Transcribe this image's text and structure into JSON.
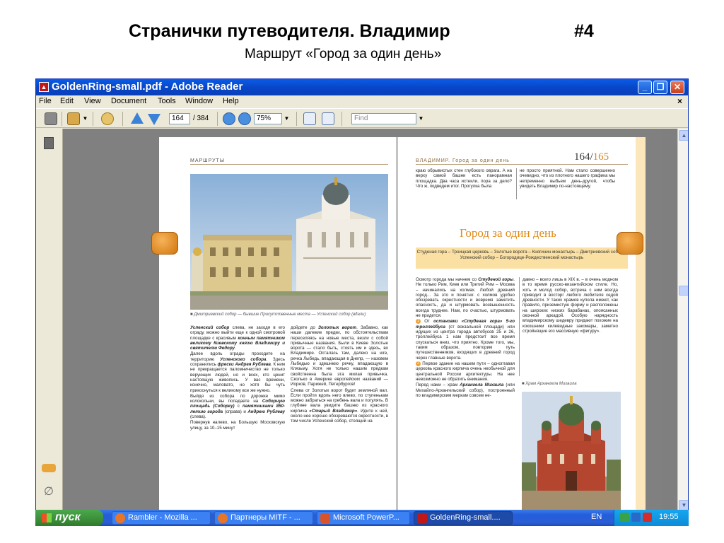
{
  "slide": {
    "title": "Странички путеводителя. Владимир",
    "number": "#4",
    "subtitle": "Маршрут «Город за один день»"
  },
  "window": {
    "title": "GoldenRing-small.pdf - Adobe Reader",
    "menu": [
      "File",
      "Edit",
      "View",
      "Document",
      "Tools",
      "Window",
      "Help"
    ],
    "close_doc": "×"
  },
  "toolbar": {
    "page_current": "164",
    "page_total": "/ 384",
    "zoom": "75%",
    "find_placeholder": "Find"
  },
  "document": {
    "left_page": {
      "running_head": "МАРШРУТЫ",
      "photo_caption": "■ Дмитриевский собор — бывшие Присутственные места — Успенский собор (вдали)",
      "col1": [
        {
          "bold": "Успенский собор",
          "text": " слева, не заходя в его ограду, можно выйти еще к одной смотровой площадке с красивым "
        },
        {
          "bold": "конным памятником великому Киевскому князю Владимиру и святителю Федору",
          "text": "."
        },
        {
          "bold": "",
          "text": "Далее вдоль ограды проходите на территорию "
        },
        {
          "bold": "Успенского собора",
          "text": ". Здесь сохранились "
        },
        {
          "bold": "фрески Андрея Рублева",
          "text": ". К ним не прекращается паломничество не только верующих людей, но и всех, кто ценит настоящую живопись. У вас времени, конечно, маловато, но хотя бы чуть прикоснуться к великому все же нужно."
        },
        {
          "bold": "",
          "text": "Выйдя из собора по дорожке мимо колокольни, вы попадаете на "
        },
        {
          "bold": "Соборную площадь (Соборку)",
          "text": " с "
        },
        {
          "bold": "памятниками 850-летию города",
          "text": " (справа) и "
        },
        {
          "bold": "Андрею Рублеву",
          "text": " (слева)."
        },
        {
          "bold": "",
          "text": "Повернув налево, на Большую Московскую улицу, за 10–15 минут"
        }
      ],
      "col2": [
        {
          "bold": "",
          "text": "дойдете до "
        },
        {
          "bold": "Золотых ворот",
          "text": ". Забавно, как наши далекие предки, по обстоятельствам переселяясь на новые места, везли с собой привычные названия. Были в Киеве Золотые ворота — стало быть, стоять им и здесь, во Владимире. Осталась там, далеко на юге, речка Лыбедь, впадающая в Днепр, — назовем Лыбедью и здешнюю речку, впадающую в Клязьму. Хотя не только нашим предкам свойственна была эта милая привычка. Сколько в Америке европейских названий — Иорков, Парижей, Петербургов!"
        },
        {
          "bold": "",
          "text": "Слева от Золотых ворот будет земляной вал. Если пройти вдоль него влево, по ступенькам можно забраться на гребень вала и погулять. В глубине вала увидите башню из красного кирпича "
        },
        {
          "bold": "«Старый Владимир»",
          "text": ". Идите к ней, около нее хорошо обозреваются окрестности, в том числе Успенский собор, стоящий на"
        }
      ]
    },
    "right_page": {
      "running_head": "ВЛАДИМИР. Город за один день",
      "page_pair_a": "164/",
      "page_pair_b": "165",
      "top_col1": "краю обрывистых стен глубокого оврага. А на верху самой башни есть панорамная площадка. Два часа истекли, пора за дело? Что ж, подведем итог. Прогулка была",
      "top_col2": "не просто приятной. Нам стало совершенно очевидно, что из плотного нашего графика мы непременно выбьем день-другой, чтобы увидеть Владимир по-настоящему.",
      "section_title": "Город за один день",
      "route": "Студеная гора – Троицкая церковь – Золотые ворота – Княгинин монастырь – Дмитриевский собор – Успенский собор – Богородице-Рождественский монастырь",
      "col1_intro_a": "Осмотр города мы начнем со ",
      "col1_intro_bold": "Студеной горы",
      "col1_intro_b": ". Не только Рим, Киев или Третий Рим – Москва – начинались на холмах. Любой древний город... За это и понятно: с холмов удобно обозревать окрестности и вовремя заметить опасность, да и штурмовать возвышенность всегда труднее. Нам, по счастью, штурмовать не придется.",
      "num1": "1",
      "col1_p2_a": " От ",
      "col1_p2_bold": "остановки «Студеная гора» 5-го троллейбуса",
      "col1_p2_b": " (ст вокзальной площади) или идущих из центра города автобусов 25 и 26, троллейбуса 1 нам предстоит все время спускаться вниз, что приятно. Кроме того, мы, таким образом, повторим путь путешественников, входящих в древний город через главные ворота.",
      "num2": "2",
      "col1_p3": " Первое здание на нашем пути – одноглавая церковь красного кирпича очень необычной для центральной России архитектуры. На нее невозможно не обратить внимания.",
      "col1_p4_a": "Перед нами – храм ",
      "col1_p4_bold": "Архангела Михаила",
      "col1_p4_b": " (или Михайло-Архангельский собор), построенный по владимирским меркам совсем не-",
      "col2_text": "давно – всего лишь в XIX в. – в очень модном в то время русско-византийском стиле. Но, хоть и молод собор, встреча с ним всегда приводит в восторг любого любителя седой древности. У таких храмов купола имеют, как правило, приземистую форму и расположены на широких низких барабанах, опоясанных оконной аркадой. Особую нарядность владимирскому шедевру придают похожие на кокошники килевидные закомары, заметно стройнящие его массивную «фигуру».",
      "photo_caption": "■ Храм Архангела Михаила"
    }
  },
  "taskbar": {
    "start_label": "пуск",
    "buttons": [
      {
        "label": "Rambler - Mozilla ..."
      },
      {
        "label": "Партнеры MITF - ..."
      },
      {
        "label": "Microsoft PowerP..."
      },
      {
        "label": "GoldenRing-small...."
      }
    ],
    "lang": "EN",
    "clock": "19:55"
  },
  "colors": {
    "accent_orange": "#e08b18",
    "route_box_bg": "#fbe0a3",
    "xp_blue": "#245edb",
    "start_green": "#3c8e3a"
  },
  "icons": [
    "pdf-icon",
    "print-icon",
    "email-icon",
    "hand-tool-icon",
    "up-arrow-icon",
    "down-arrow-icon",
    "zoom-out-icon",
    "zoom-in-icon",
    "fit-page-icon",
    "fit-width-icon",
    "pages-panel-icon",
    "comments-icon",
    "attachment-icon",
    "windows-logo-icon",
    "firefox-icon",
    "powerpoint-icon",
    "adobe-icon"
  ]
}
